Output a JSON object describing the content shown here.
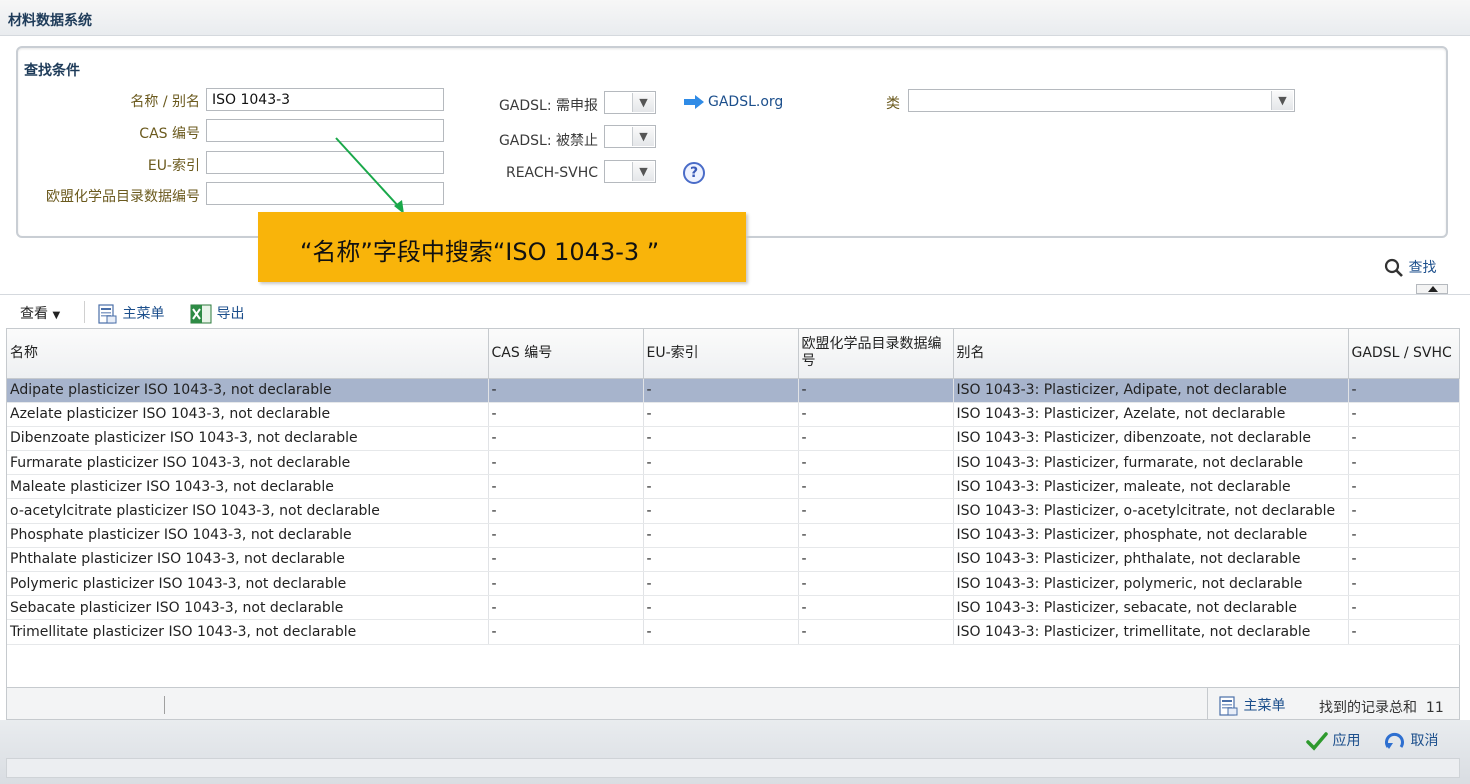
{
  "window": {
    "title": "材料数据系统"
  },
  "search_panel": {
    "title": "查找条件",
    "name_label": "名称 / 别名",
    "name_value": "ISO 1043-3",
    "cas_label": "CAS 编号",
    "eu_label": "EU-索引",
    "ecl_label": "欧盟化学品目录数据编号",
    "gadsl_declare_label": "GADSL: 需申报",
    "gadsl_prohibited_label": "GADSL: 被禁止",
    "reach_label": "REACH-SVHC",
    "gadsl_link": "GADSL.org",
    "class_label": "类",
    "search_button": "查找"
  },
  "callout": {
    "text": "“名称”字段中搜索“ISO 1043-3 ”"
  },
  "toolbar": {
    "view": "查看",
    "main_menu": "主菜单",
    "export": "导出"
  },
  "table": {
    "headers": [
      "名称",
      "CAS 编号",
      "EU-索引",
      "欧盟化学品目录数据编号",
      "别名",
      "GADSL / SVHC"
    ],
    "rows": [
      [
        "Adipate plasticizer ISO 1043-3, not declarable",
        "-",
        "-",
        "-",
        "ISO 1043-3: Plasticizer, Adipate, not declarable",
        "-"
      ],
      [
        "Azelate plasticizer ISO 1043-3, not declarable",
        "-",
        "-",
        "-",
        "ISO 1043-3: Plasticizer, Azelate, not declarable",
        "-"
      ],
      [
        "Dibenzoate plasticizer ISO 1043-3, not declarable",
        "-",
        "-",
        "-",
        "ISO 1043-3: Plasticizer, dibenzoate, not declarable",
        "-"
      ],
      [
        "Furmarate plasticizer ISO 1043-3, not declarable",
        "-",
        "-",
        "-",
        "ISO 1043-3: Plasticizer, furmarate, not declarable",
        "-"
      ],
      [
        "Maleate plasticizer ISO 1043-3, not declarable",
        "-",
        "-",
        "-",
        "ISO 1043-3: Plasticizer, maleate, not declarable",
        "-"
      ],
      [
        "o-acetylcitrate plasticizer ISO 1043-3, not declarable",
        "-",
        "-",
        "-",
        "ISO 1043-3: Plasticizer, o-acetylcitrate, not declarable",
        "-"
      ],
      [
        "Phosphate plasticizer ISO 1043-3, not declarable",
        "-",
        "-",
        "-",
        "ISO 1043-3: Plasticizer, phosphate, not declarable",
        "-"
      ],
      [
        "Phthalate plasticizer ISO 1043-3, not declarable",
        "-",
        "-",
        "-",
        "ISO 1043-3: Plasticizer, phthalate, not declarable",
        "-"
      ],
      [
        "Polymeric plasticizer ISO 1043-3, not declarable",
        "-",
        "-",
        "-",
        "ISO 1043-3: Plasticizer, polymeric, not declarable",
        "-"
      ],
      [
        "Sebacate plasticizer ISO 1043-3, not declarable",
        "-",
        "-",
        "-",
        "ISO 1043-3: Plasticizer, sebacate, not declarable",
        "-"
      ],
      [
        "Trimellitate plasticizer ISO 1043-3, not declarable",
        "-",
        "-",
        "-",
        "ISO 1043-3: Plasticizer, trimellitate, not declarable",
        "-"
      ]
    ]
  },
  "status": {
    "main_menu": "主菜单",
    "count_label": "找到的记录总和",
    "count": "11"
  },
  "footer": {
    "apply": "应用",
    "cancel": "取消"
  }
}
